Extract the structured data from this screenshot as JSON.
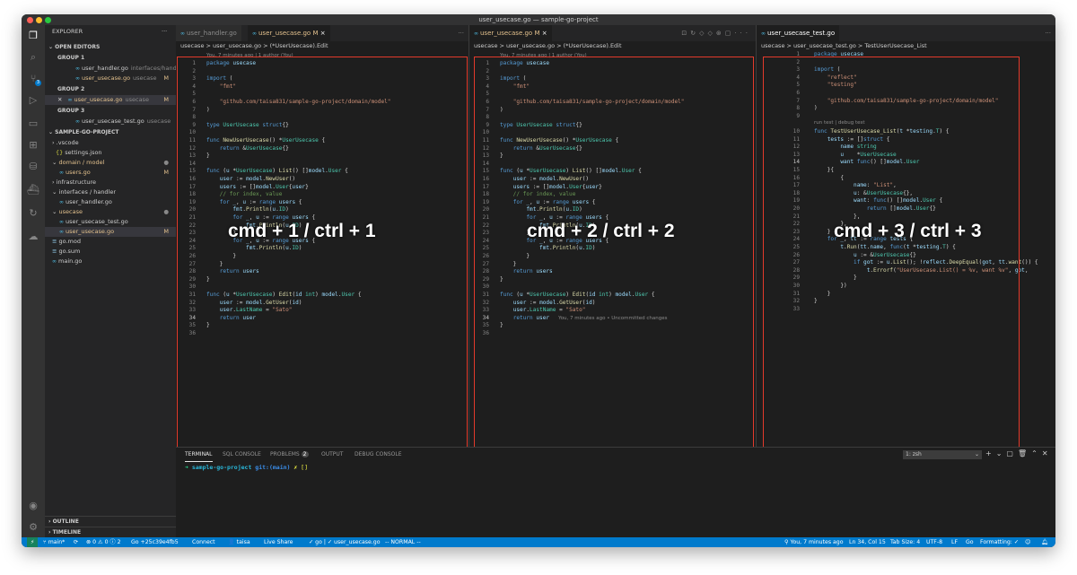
{
  "window": {
    "title": "user_usecase.go — sample-go-project"
  },
  "activity_bar": {
    "items": [
      "explorer-icon",
      "search-icon",
      "source-control-icon",
      "run-debug-icon",
      "remote-explorer-icon",
      "extensions-icon",
      "database-icon",
      "docker-icon",
      "live-share-icon",
      "git-graph-icon"
    ],
    "badge": "3"
  },
  "sidebar": {
    "title": "EXPLORER",
    "open_editors": "OPEN EDITORS",
    "group1": "GROUP 1",
    "group2": "GROUP 2",
    "group3": "GROUP 3",
    "oe1_file": "user_handler.go",
    "oe1_dir": "interfaces/handler",
    "oe2_file": "user_usecase.go",
    "oe2_dir": "usecase",
    "oe2_status": "M",
    "oe3_file": "user_usecase.go",
    "oe3_dir": "usecase",
    "oe3_status": "M",
    "oe4_file": "user_usecase_test.go",
    "oe4_dir": "usecase",
    "project": "SAMPLE-GO-PROJECT",
    "tree": [
      {
        "label": ".vscode"
      },
      {
        "label": "settings.json"
      },
      {
        "label": "domain / model",
        "status": "●"
      },
      {
        "label": "users.go",
        "status": "M"
      },
      {
        "label": "infrastructure"
      },
      {
        "label": "interfaces / handler"
      },
      {
        "label": "user_handler.go"
      },
      {
        "label": "usecase",
        "status": "●"
      },
      {
        "label": "user_usecase_test.go"
      },
      {
        "label": "user_usecase.go",
        "status": "M"
      },
      {
        "label": "go.mod"
      },
      {
        "label": "go.sum"
      },
      {
        "label": "main.go"
      }
    ],
    "outline": "OUTLINE",
    "timeline": "TIMELINE"
  },
  "pane1": {
    "tab1": "user_handler.go",
    "tab2": "user_usecase.go",
    "tab2_status": "M",
    "tab2_close": "×",
    "breadcrumb": "usecase > user_usecase.go > (*UserUsecase).Edit",
    "blame": "You, 7 minutes ago | 1 author (You)",
    "overlay": "cmd + 1 / ctrl + 1"
  },
  "pane2": {
    "tab1": "user_usecase.go",
    "tab1_status": "M",
    "tab1_close": "×",
    "breadcrumb": "usecase > user_usecase.go > (*UserUsecase).Edit",
    "blame": "You, 7 minutes ago | 1 author (You)",
    "inline_blame": "You, 7 minutes ago • Uncommitted changes",
    "overlay": "cmd + 2 / ctrl + 2"
  },
  "pane3": {
    "tab1": "user_usecase_test.go",
    "breadcrumb": "usecase > user_usecase_test.go > TestUserUsecase_List",
    "codelens": "run test | debug test",
    "overlay": "cmd + 3 / ctrl + 3"
  },
  "code_usecase": [
    "package usecase",
    "",
    "import (",
    "    \"fmt\"",
    "",
    "    \"github.com/taisa831/sample-go-project/domain/model\"",
    ")",
    "",
    "type UserUsecase struct{}",
    "",
    "func NewUserUsecase() *UserUsecase {",
    "    return &UserUsecase{}",
    "}",
    "",
    "func (u *UserUsecase) List() []model.User {",
    "    user := model.NewUser()",
    "    users := []model.User{user}",
    "    // for index, value",
    "    for _, u := range users {",
    "        fmt.Println(u.ID)",
    "        for _, u := range users {",
    "            fmt.Println(u.ID)",
    "        }",
    "        for _, u := range users {",
    "            fmt.Println(u.ID)",
    "        }",
    "    }",
    "    return users",
    "}",
    "",
    "func (u *UserUsecase) Edit(id int) model.User {",
    "    user := model.GetUser(id)",
    "    user.LastName = \"Sato\"",
    "    return user",
    "}",
    ""
  ],
  "code_test": [
    "package usecase",
    "",
    "import (",
    "    \"reflect\"",
    "    \"testing\"",
    "",
    "    \"github.com/taisa831/sample-go-project/domain/model\"",
    ")",
    "",
    "func TestUserUsecase_List(t *testing.T) {",
    "    tests := []struct {",
    "        name string",
    "        u    *UserUsecase",
    "        want func() []model.User",
    "    }{",
    "        {",
    "            name: \"List\",",
    "            u: &UserUsecase{},",
    "            want: func() []model.User {",
    "                return []model.User{}",
    "            },",
    "        },",
    "    }",
    "    for _, tt := range tests {",
    "        t.Run(tt.name, func(t *testing.T) {",
    "            u := &UserUsecase{}",
    "            if got := u.List(); !reflect.DeepEqual(got, tt.want()) {",
    "                t.Errorf(\"UserUsecase.List() = %v, want %v\", got,",
    "            }",
    "        })",
    "    }",
    "}",
    ""
  ],
  "panel": {
    "tabs": [
      "TERMINAL",
      "SQL CONSOLE",
      "PROBLEMS",
      "OUTPUT",
      "DEBUG CONSOLE"
    ],
    "problems_count": "2",
    "shell_select": "1: zsh",
    "prompt_arrow": "➜",
    "prompt_dir": "sample-go-project",
    "prompt_git": "git:(main)",
    "prompt_end": "✗ []"
  },
  "statusbar": {
    "branch": "main*",
    "sync": "⟳",
    "errors": "⊗ 0 ⚠ 0 ⓘ 2",
    "commit": "Go +25c39e4fb5",
    "connect": "Connect",
    "user": "taisa",
    "live_share": "Live Share",
    "file_check": "✓ go | ✓ user_usecase.go",
    "mode": "-- NORMAL --",
    "blame": "You, 7 minutes ago",
    "position": "Ln 34, Col 15",
    "tab_size": "Tab Size: 4",
    "encoding": "UTF-8",
    "eol": "LF",
    "language": "Go",
    "formatting": "Formatting: ✓"
  },
  "colors": {
    "accent": "#007acc",
    "highlight_box": "#e33a2b",
    "modified": "#e2c08d"
  }
}
